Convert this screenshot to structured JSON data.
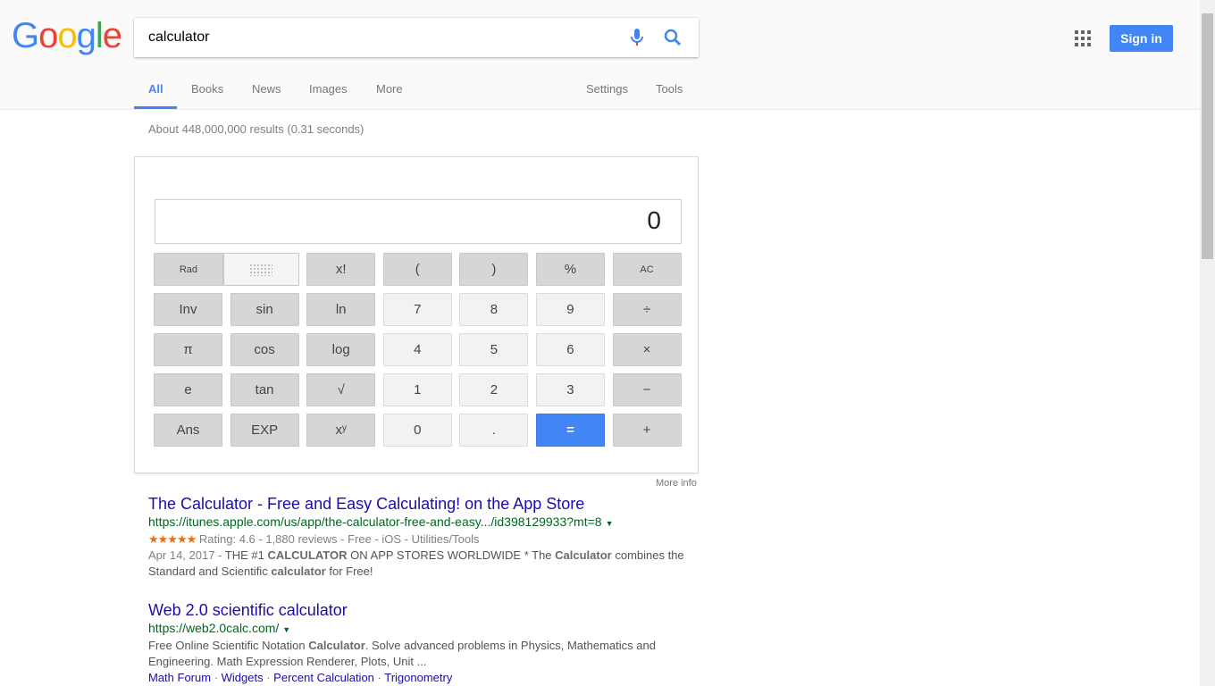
{
  "header": {
    "logo": "Google",
    "query": "calculator",
    "sign_in": "Sign in",
    "tabs": [
      "All",
      "Books",
      "News",
      "Images",
      "More"
    ],
    "settings": "Settings",
    "tools": "Tools"
  },
  "stats": "About 448,000,000 results (0.31 seconds)",
  "calculator": {
    "display": "0",
    "rad": "Rad",
    "buttons": [
      "x!",
      "(",
      ")",
      "%",
      "AC",
      "Inv",
      "sin",
      "ln",
      "7",
      "8",
      "9",
      "÷",
      "π",
      "cos",
      "log",
      "4",
      "5",
      "6",
      "×",
      "e",
      "tan",
      "√",
      "1",
      "2",
      "3",
      "−",
      "Ans",
      "EXP",
      "xʸ",
      "0",
      ".",
      "=",
      "+"
    ],
    "more_info": "More info"
  },
  "results": [
    {
      "title": "The Calculator - Free and Easy Calculating! on the App Store",
      "url": "https://itunes.apple.com/us/app/the-calculator-free-and-easy.../id398129933?mt=8",
      "stars": "★★★★★",
      "rating": "Rating: 4.6 - 1,880 reviews - Free - iOS - Utilities/Tools",
      "date": "Apr 14, 2017 - ",
      "snippet_parts": [
        "THE #1 ",
        "CALCULATOR",
        " ON APP STORES WORLDWIDE * The ",
        "Calculator",
        " combines the Standard and Scientific ",
        "calculator",
        " for Free!"
      ]
    },
    {
      "title": "Web 2.0 scientific calculator",
      "url": "https://web2.0calc.com/",
      "snippet_parts": [
        "Free Online Scientific Notation ",
        "Calculator",
        ". Solve advanced problems in Physics, Mathematics and Engineering. Math Expression Renderer, Plots, Unit ..."
      ],
      "sitelinks": [
        "Math Forum",
        "Widgets",
        "Percent Calculation",
        "Trigonometry"
      ]
    }
  ],
  "colors": {
    "accent": "#4285f4",
    "link": "#1a0dab",
    "url": "#006621"
  }
}
